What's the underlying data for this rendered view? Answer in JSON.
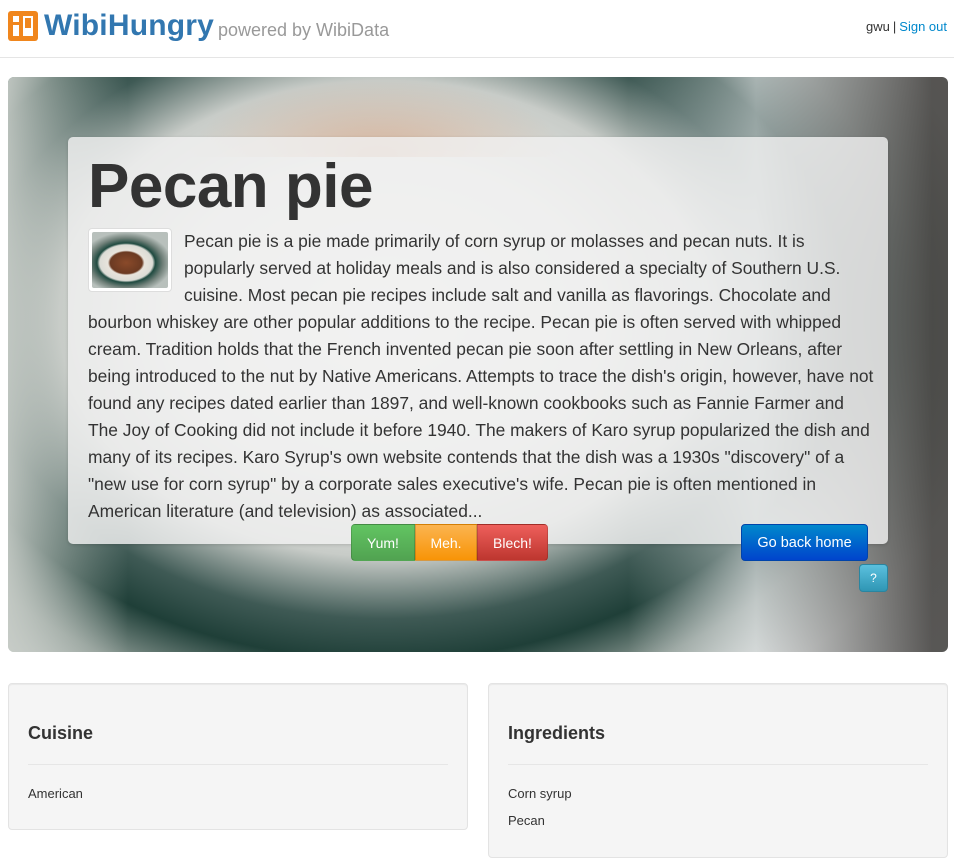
{
  "header": {
    "brand": "WibiHungry",
    "tagline": "powered by WibiData",
    "user": "gwu",
    "separator": "|",
    "signout_label": "Sign out"
  },
  "dish": {
    "title": "Pecan pie",
    "description": "Pecan pie is a pie made primarily of corn syrup or molasses and pecan nuts. It is popularly served at holiday meals and is also considered a specialty of Southern U.S. cuisine. Most pecan pie recipes include salt and vanilla as flavorings. Chocolate and bourbon whiskey are other popular additions to the recipe. Pecan pie is often served with whipped cream. Tradition holds that the French invented pecan pie soon after settling in New Orleans, after being introduced to the nut by Native Americans. Attempts to trace the dish's origin, however, have not found any recipes dated earlier than 1897, and well-known cookbooks such as Fannie Farmer and The Joy of Cooking did not include it before 1940. The makers of Karo syrup popularized the dish and many of its recipes. Karo Syrup's own website contends that the dish was a 1930s \"discovery\" of a \"new use for corn syrup\" by a corporate sales executive's wife. Pecan pie is often mentioned in American literature (and television) as associated..."
  },
  "vote": {
    "yum_label": "Yum!",
    "meh_label": "Meh.",
    "blech_label": "Blech!"
  },
  "actions": {
    "home_label": "Go back home",
    "help_label": "?"
  },
  "cuisine": {
    "heading": "Cuisine",
    "items": [
      "American"
    ]
  },
  "ingredients": {
    "heading": "Ingredients",
    "items": [
      "Corn syrup",
      "Pecan"
    ]
  },
  "colors": {
    "brand": "#3277b0",
    "logo": "#f0861d",
    "link": "#0088cc",
    "yum": "#5bb75b",
    "meh": "#faa732",
    "blech": "#da4f49",
    "primary": "#0066cc",
    "info": "#49afcd"
  }
}
